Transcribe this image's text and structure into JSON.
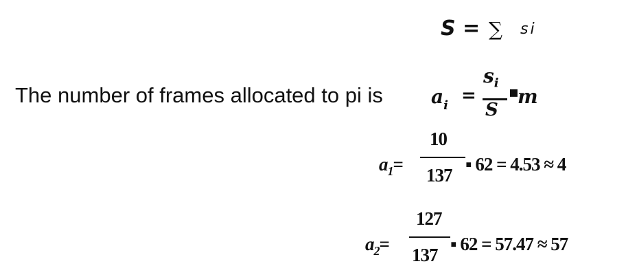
{
  "equation_total": {
    "lhs": "S",
    "equals": "=",
    "sum_symbol": "∑",
    "term": "si"
  },
  "allocation": {
    "sentence": "The number of frames allocated to pi is",
    "var": "a",
    "var_sub": "i",
    "equals": "=",
    "numerator": "s",
    "numerator_sub": "i",
    "denominator": "S",
    "dot": "▪",
    "factor": "m"
  },
  "calc_rows": [
    {
      "var": "a",
      "sub": "1",
      "equals": "=",
      "numerator": "10",
      "denominator": "137",
      "rest": "▪ 62 =  4.53 ≈ 4"
    },
    {
      "var": "a",
      "sub": "2",
      "equals": "=",
      "numerator": "127",
      "denominator": "137",
      "rest": "▪ 62 =  57.47 ≈ 57"
    }
  ]
}
